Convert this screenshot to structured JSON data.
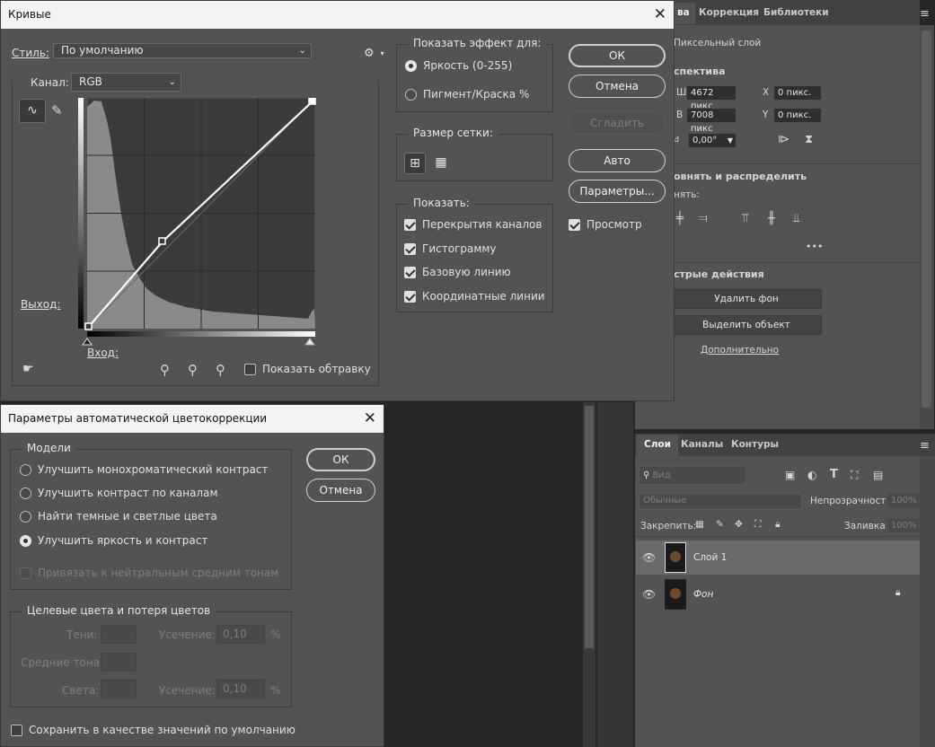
{
  "curves": {
    "title": "Кривые",
    "style_label": "Стиль:",
    "style_value": "По умолчанию",
    "channel_label": "Канал:",
    "channel_value": "RGB",
    "output_label": "Выход:",
    "input_label": "Вход:",
    "show_clipping": "Показать обтравку",
    "show_effect_title": "Показать эффект для:",
    "effect_options": [
      "Яркость (0-255)",
      "Пигмент/Краска %"
    ],
    "grid_size_title": "Размер сетки:",
    "show_title": "Показать:",
    "show_options": [
      "Перекрытия каналов",
      "Гистограмму",
      "Базовую линию",
      "Координатные линии"
    ],
    "buttons": {
      "ok": "ОК",
      "cancel": "Отмена",
      "smooth": "Сгладить",
      "auto": "Авто",
      "options": "Параметры..."
    },
    "preview": "Просмотр"
  },
  "autocolor": {
    "title": "Параметры автоматической цветокоррекции",
    "models_title": "Модели",
    "models": [
      "Улучшить монохроматический контраст",
      "Улучшить контраст по каналам",
      "Найти темные и светлые цвета",
      "Улучшить яркость и контраст"
    ],
    "snap_neutral": "Привязать к нейтральным средним тонам",
    "targets_title": "Целевые цвета и потеря цветов",
    "shadows": "Тени:",
    "midtones": "Средние тона:",
    "highlights": "Света:",
    "clip_label": "Усечение:",
    "clip_shadows": "0,10",
    "clip_highlights": "0,10",
    "percent": "%",
    "save_default": "Сохранить в качестве значений по умолчанию",
    "buttons": {
      "ok": "ОК",
      "cancel": "Отмена"
    }
  },
  "properties": {
    "tabs": [
      "ва",
      "Коррекция",
      "Библиотеки"
    ],
    "layer_type": "Пиксельный слой",
    "transform_title": "спектива",
    "w_label": "Ш",
    "w_value": "4672 пикс",
    "h_label": "В",
    "h_value": "7008 пикс",
    "x_label": "X",
    "x_value": "0 пикс.",
    "y_label": "Y",
    "y_value": "0 пикс.",
    "angle_value": "0,00°",
    "align_title": "овнять и распределить",
    "align_sub": "нять:",
    "more": "•••",
    "quick_title": "стрые действия",
    "remove_bg": "Удалить фон",
    "select_subject": "Выделить объект",
    "more_link": "Дополнительно"
  },
  "layers": {
    "tabs": [
      "Слои",
      "Каналы",
      "Контуры"
    ],
    "search_placeholder": "Вид",
    "blend_mode": "Обычные",
    "opacity_label": "Непрозрачность:",
    "opacity_value": "100%",
    "lock_label": "Закрепить:",
    "fill_label": "Заливка:",
    "fill_value": "100%",
    "items": [
      "Слой 1",
      "Фон"
    ]
  }
}
